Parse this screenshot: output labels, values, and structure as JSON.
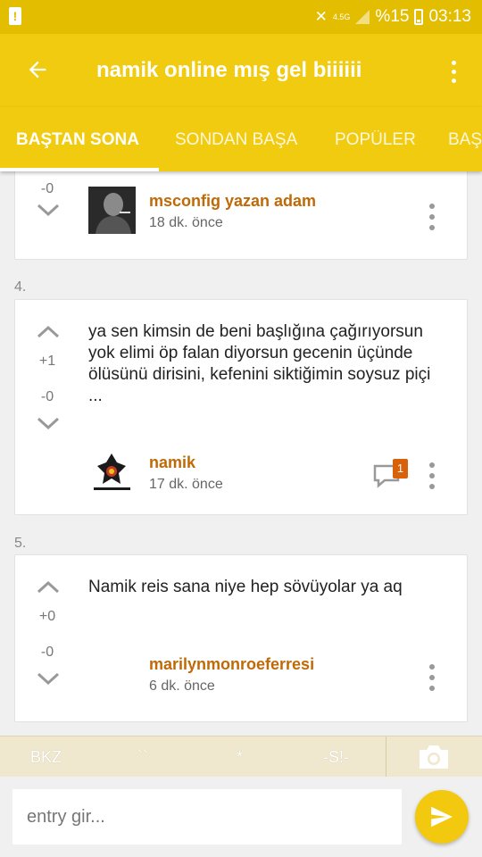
{
  "status_bar": {
    "network": "4.5G",
    "battery": "%15",
    "time": "03:13"
  },
  "toolbar": {
    "title": "namik online mış gel biiiiii"
  },
  "tabs": [
    {
      "label": "BAŞTAN SONA",
      "active": true
    },
    {
      "label": "SONDAN BAŞA",
      "active": false
    },
    {
      "label": "POPÜLER",
      "active": false
    },
    {
      "label": "BAŞ",
      "active": false
    }
  ],
  "entries": [
    {
      "number": "",
      "text": "",
      "upvotes": "",
      "downvotes": "-0",
      "author": "msconfig yazan adam",
      "time": "18 dk. önce"
    },
    {
      "number": "4.",
      "text": "ya sen kimsin de beni başlığına çağırıyorsun yok elimi öp falan diyorsun gecenin üçünde ölüsünü dirisini, kefenini siktiğimin soysuz piçi ...",
      "upvotes": "+1",
      "downvotes": "-0",
      "author": "namik",
      "time": "17 dk. önce",
      "comment_count": "1"
    },
    {
      "number": "5.",
      "text": "Namik reis sana niye hep sövüyolar ya aq",
      "upvotes": "+0",
      "downvotes": "-0",
      "author": "marilynmonroeferresi",
      "time": "6 dk. önce"
    }
  ],
  "format_bar": {
    "bkz": "BKZ",
    "backtick": "``",
    "star": "*",
    "spoiler": "-S!-"
  },
  "input": {
    "placeholder": "entry gir..."
  },
  "colors": {
    "toolbar": "#f1cb0f",
    "status_bar": "#e3bd00",
    "author": "#c06a07",
    "badge": "#d7620a"
  }
}
